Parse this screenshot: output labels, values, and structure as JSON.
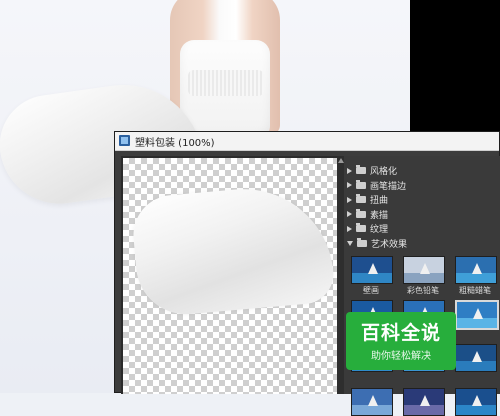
{
  "dialog": {
    "title": "塑料包装 (100%)"
  },
  "tree": {
    "items": [
      {
        "label": "风格化",
        "expanded": false
      },
      {
        "label": "画笔描边",
        "expanded": false
      },
      {
        "label": "扭曲",
        "expanded": false
      },
      {
        "label": "素描",
        "expanded": false
      },
      {
        "label": "纹理",
        "expanded": false
      },
      {
        "label": "艺术效果",
        "expanded": true
      }
    ],
    "thumbnails": [
      {
        "label": "壁画",
        "selected": false,
        "sky": "#1e4f8f",
        "sea": "#2f86c5"
      },
      {
        "label": "彩色铅笔",
        "selected": false,
        "sky": "#c8d2e0",
        "sea": "#8aa3c0"
      },
      {
        "label": "粗糙蜡笔",
        "selected": false,
        "sky": "#2b6fb0",
        "sea": "#3f9fd8"
      },
      {
        "label": "",
        "selected": false,
        "sky": "#1a5aa0",
        "sea": "#2c8bd0"
      },
      {
        "label": "",
        "selected": false,
        "sky": "#2a70b8",
        "sea": "#46a4de"
      },
      {
        "label": "",
        "selected": true,
        "sky": "#2f7ec4",
        "sea": "#5ab4e6"
      },
      {
        "label": "",
        "selected": false,
        "sky": "#1c5c9e",
        "sea": "#2f8ccc"
      },
      {
        "label": "",
        "selected": false,
        "sky": "#24659f",
        "sea": "#3a95d2"
      },
      {
        "label": "",
        "selected": false,
        "sky": "#1b4f88",
        "sea": "#2a7cbc"
      },
      {
        "label": "",
        "selected": false,
        "sky": "#3d6eb2",
        "sea": "#7aa8d8"
      },
      {
        "label": "",
        "selected": false,
        "sky": "#2a3a78",
        "sea": "#6a6aa8"
      },
      {
        "label": "",
        "selected": false,
        "sky": "#1a4f8e",
        "sea": "#2c86c8"
      }
    ]
  },
  "watermark": {
    "main": "百科全说",
    "sub": "助你轻松解决"
  },
  "colors": {
    "dialog_bg": "#3c3c3c",
    "watermark_green": "#27ae3c"
  }
}
